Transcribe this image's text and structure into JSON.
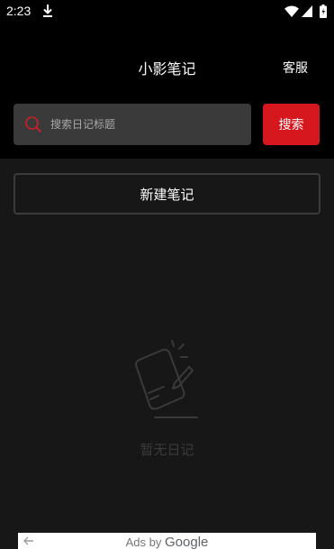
{
  "status_bar": {
    "time": "2:23",
    "icons": [
      "download-icon",
      "wifi-icon",
      "signal-icon",
      "battery-icon"
    ]
  },
  "header": {
    "title": "小影笔记",
    "service_label": "客服"
  },
  "search": {
    "placeholder": "搜索日记标题",
    "button_label": "搜索"
  },
  "new_note": {
    "label": "新建笔记"
  },
  "empty_state": {
    "icon": "empty-notebook-icon",
    "text": "暂无日记"
  },
  "ad": {
    "prefix": "Ads by",
    "brand": "Google"
  },
  "colors": {
    "accent": "#d6171d",
    "background": "#171717",
    "header_background": "#000000",
    "search_field": "#3a3a3a"
  }
}
